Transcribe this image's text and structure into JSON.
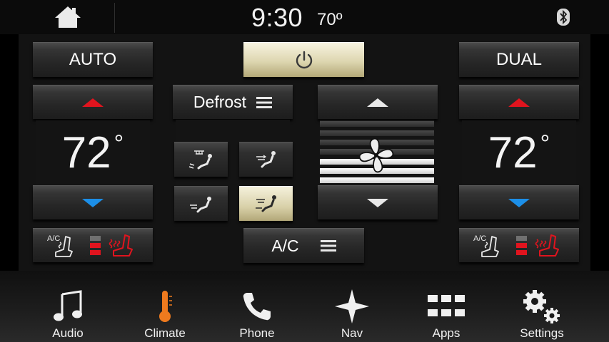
{
  "status": {
    "time": "9:30",
    "outside_temp": "70º"
  },
  "climate": {
    "auto_label": "AUTO",
    "dual_label": "DUAL",
    "driver": {
      "temp_value": "72",
      "temp_unit": "°"
    },
    "passenger": {
      "temp_value": "72",
      "temp_unit": "°"
    },
    "defrost_label": "Defrost",
    "ac_label": "A/C",
    "seat_ac_label": "A/C",
    "fan_speed_level": 3,
    "fan_speed_max": 7,
    "active_airflow_mode": "floor"
  },
  "colors": {
    "up_arrow_red": "#e0141e",
    "down_arrow_blue": "#1c8fe8",
    "accent_gold": "#d8d0a8",
    "climate_icon_orange": "#ee7a1e",
    "seat_heat_red": "#e0141e"
  },
  "nav": {
    "items": [
      {
        "label": "Audio",
        "icon": "music-note-icon"
      },
      {
        "label": "Climate",
        "icon": "thermometer-icon"
      },
      {
        "label": "Phone",
        "icon": "phone-icon"
      },
      {
        "label": "Nav",
        "icon": "compass-star-icon"
      },
      {
        "label": "Apps",
        "icon": "apps-grid-icon"
      },
      {
        "label": "Settings",
        "icon": "gears-icon"
      }
    ]
  }
}
